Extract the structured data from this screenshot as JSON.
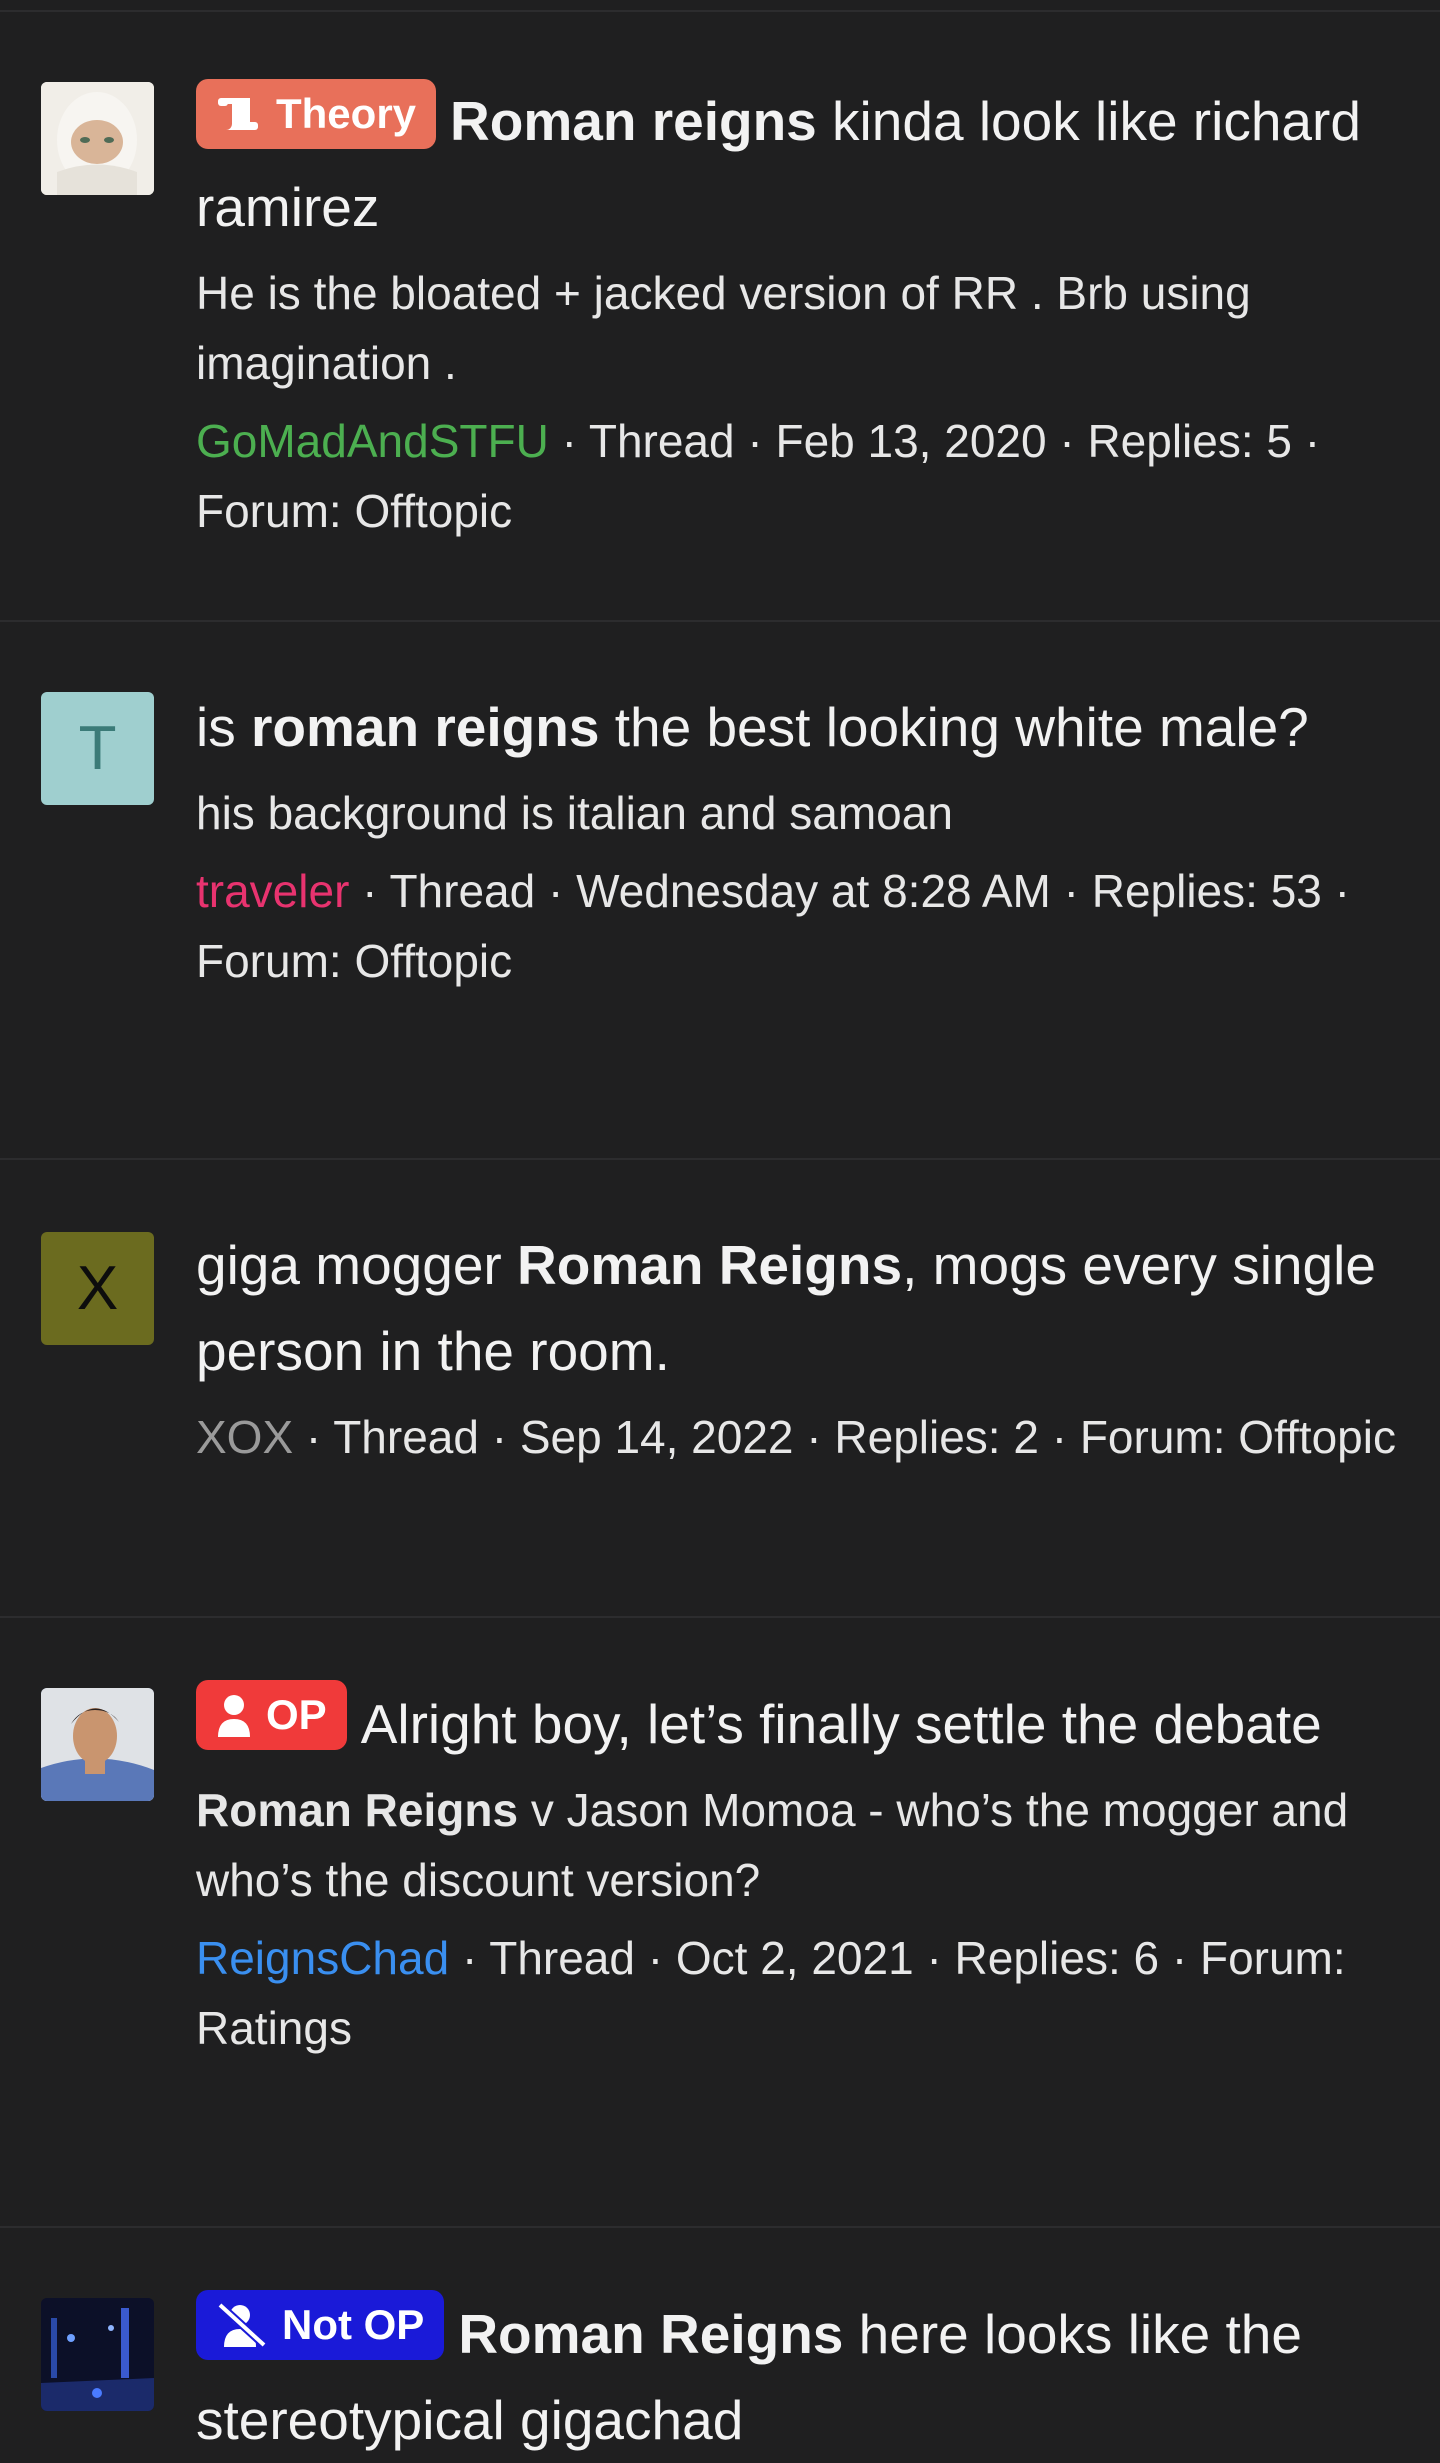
{
  "results": [
    {
      "avatar": {
        "type": "image",
        "desc": "face"
      },
      "prefix": {
        "label": "Theory",
        "color": "#e8705a",
        "icon": "scroll-icon"
      },
      "title_pre": "",
      "title_bold": "Roman reigns",
      "title_post": " kinda look like richard ramirez",
      "snippet_bold": "",
      "snippet": "He is the bloated + jacked version of RR . Brb using imagination .",
      "user": "GoMadAndSTFU",
      "user_color": "#4caf50",
      "meta": " · Thread · Feb 13, 2020 · Replies: 5 · Forum: Offtopic"
    },
    {
      "avatar": {
        "type": "letter",
        "letter": "T",
        "bg": "#9fcfcf",
        "fg": "#3b7b78"
      },
      "prefix": null,
      "title_pre": "is ",
      "title_bold": "roman reigns",
      "title_post": " the best looking white male?",
      "snippet_bold": "",
      "snippet": "his background is italian and samoan",
      "user": "traveler",
      "user_color": "#e8336f",
      "meta": " · Thread · Wednesday at 8:28 AM · Replies: 53 · Forum: Offtopic"
    },
    {
      "avatar": {
        "type": "letter",
        "letter": "X",
        "bg": "#6b6b1f",
        "fg": "#0d0d0d"
      },
      "prefix": null,
      "title_pre": "giga mogger ",
      "title_bold": "Roman Reigns",
      "title_post": ", mogs every single person in the room.",
      "snippet_bold": "",
      "snippet": "",
      "user": "XOX",
      "user_color": "#9a9a9a",
      "meta": " · Thread · Sep 14, 2022 · Replies: 2 · Forum: Offtopic"
    },
    {
      "avatar": {
        "type": "image",
        "desc": "man portrait"
      },
      "prefix": {
        "label": "OP",
        "color": "#f03a3a",
        "icon": "user-icon"
      },
      "title_pre": "",
      "title_bold": "",
      "title_post": "Alright boy, let’s finally settle the debate",
      "snippet_bold": "Roman Reigns",
      "snippet": " v Jason Momoa - who’s the mogger and who’s the discount version?",
      "user": "ReignsChad",
      "user_color": "#3a8ff0",
      "meta": " · Thread · Oct 2, 2021 · Replies: 6 · Forum: Ratings"
    },
    {
      "avatar": {
        "type": "image",
        "desc": "night scene"
      },
      "prefix": {
        "label": "Not OP",
        "color": "#1a1ad8",
        "icon": "user-slash-icon"
      },
      "title_pre": "",
      "title_bold": "Roman Reigns",
      "title_post": " here looks like the stereotypical gigachad",
      "snippet_bold": "",
      "snippet": "",
      "user": "",
      "user_color": "#ececec",
      "meta": ""
    }
  ]
}
